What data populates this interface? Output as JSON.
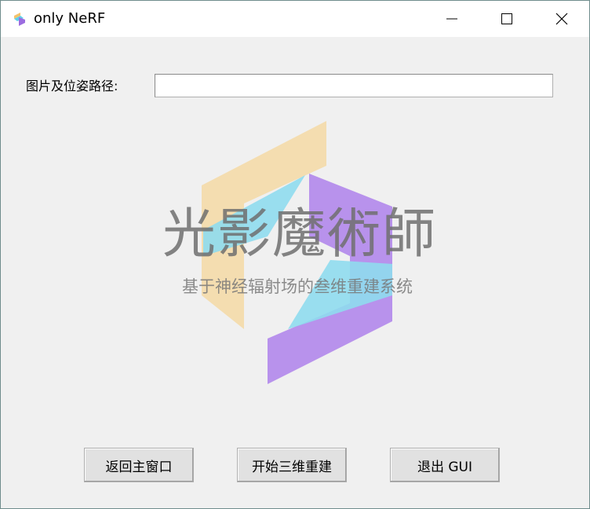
{
  "window": {
    "title": "only NeRF",
    "icon": "app-logo-icon",
    "controls": [
      "minimize-icon",
      "maximize-icon",
      "close-icon"
    ]
  },
  "form": {
    "path_label": "图片及位姿路径:",
    "path_value": "",
    "path_placeholder": ""
  },
  "logo": {
    "title": "光影魔術師",
    "subtitle": "基于神经辐射场的叁维重建系统",
    "colors": {
      "yellow": "#f4ddb0",
      "cyan": "#8fdcee",
      "purple": "#b892ec"
    }
  },
  "buttons": {
    "back_label": "返回主窗口",
    "start_label": "开始三维重建",
    "quit_label": "退出 GUI"
  }
}
